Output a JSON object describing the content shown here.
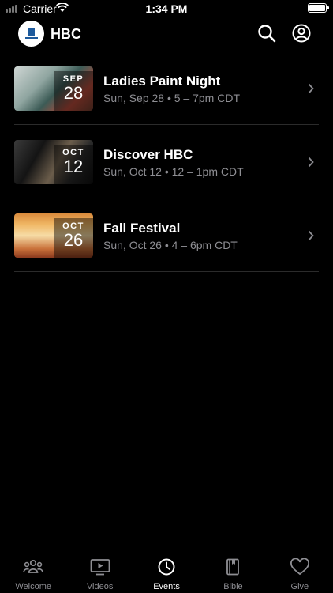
{
  "status_bar": {
    "carrier": "Carrier",
    "time": "1:34 PM"
  },
  "header": {
    "title": "HBC",
    "logo_icon": "church-logo-icon"
  },
  "events": [
    {
      "title": "Ladies Paint Night",
      "month": "SEP",
      "day": "28",
      "meta": "Sun, Sep 28 • 5 – 7pm CDT"
    },
    {
      "title": "Discover HBC",
      "month": "OCT",
      "day": "12",
      "meta": "Sun, Oct 12 • 12 – 1pm CDT"
    },
    {
      "title": "Fall Festival",
      "month": "OCT",
      "day": "26",
      "meta": "Sun, Oct 26 • 4 – 6pm CDT"
    }
  ],
  "tabs": [
    {
      "label": "Welcome",
      "icon": "people-icon",
      "active": false
    },
    {
      "label": "Videos",
      "icon": "play-screen-icon",
      "active": false
    },
    {
      "label": "Events",
      "icon": "clock-icon",
      "active": true
    },
    {
      "label": "Bible",
      "icon": "book-icon",
      "active": false
    },
    {
      "label": "Give",
      "icon": "heart-icon",
      "active": false
    }
  ],
  "colors": {
    "background": "#000000",
    "text_primary": "#ffffff",
    "text_secondary": "#8e8e93",
    "divider": "#2b2b2b"
  }
}
